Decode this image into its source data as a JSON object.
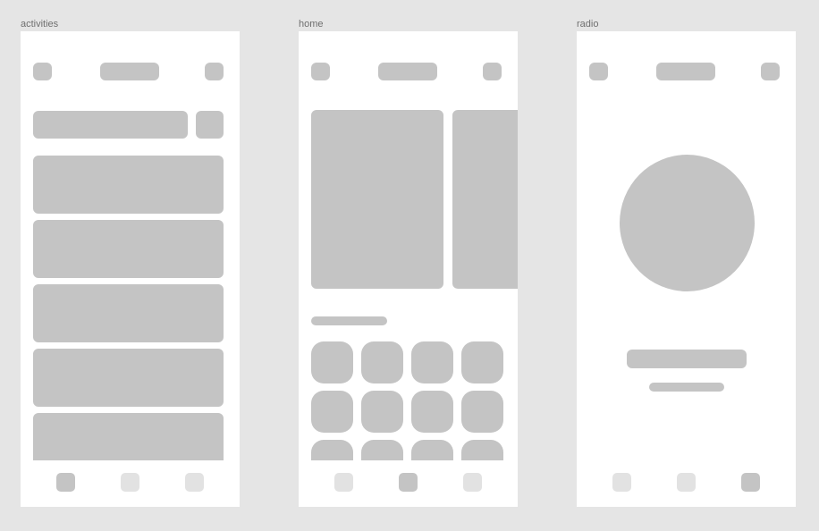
{
  "frames": {
    "activities": {
      "label": "activities"
    },
    "home": {
      "label": "home"
    },
    "radio": {
      "label": "radio"
    }
  },
  "colors": {
    "canvas": "#e5e5e5",
    "frame": "#ffffff",
    "placeholder": "#c4c4c4",
    "placeholder_light": "#e2e2e2",
    "label": "#6f6f6f"
  },
  "tab_active": {
    "activities": 0,
    "home": 1,
    "radio": 2
  }
}
